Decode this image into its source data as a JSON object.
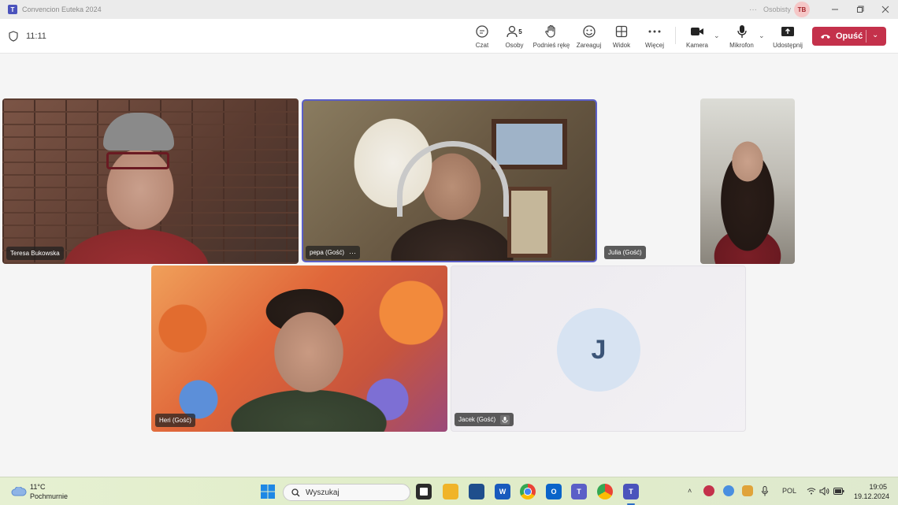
{
  "window": {
    "title": "Convencion Euteka 2024",
    "more_label": "···",
    "profile_label": "Osobisty",
    "profile_initials": "TB"
  },
  "toolbar": {
    "timer": "11:11",
    "chat_label": "Czat",
    "people_label": "Osoby",
    "people_count": "5",
    "raise_hand_label": "Podnieś rękę",
    "react_label": "Zareaguj",
    "view_label": "Widok",
    "more_label": "Więcej",
    "camera_label": "Kamera",
    "mic_label": "Mikrofon",
    "share_label": "Udostępnij",
    "leave_label": "Opuść"
  },
  "participants": {
    "teresa": "Teresa Bukowska",
    "pepa": "pepa (Gość)",
    "pepa_more": "···",
    "julia": "Julia (Gość)",
    "heri": "Heri (Gość)",
    "jacek": "Jacek (Gość)",
    "jacek_initial": "J"
  },
  "taskbar": {
    "weather_temp": "11°C",
    "weather_desc": "Pochmurnie",
    "search_label": "Wyszukaj",
    "language": "POL",
    "time": "19:05",
    "date": "19.12.2024"
  },
  "colors": {
    "accent": "#5b5fc7",
    "leave": "#c4314b",
    "teams": "#4b53bc"
  }
}
